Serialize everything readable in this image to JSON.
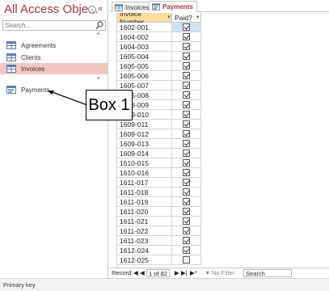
{
  "nav": {
    "title": "All Access Obje...",
    "search_placeholder": "Search...",
    "items": [
      {
        "label": "Agreements"
      },
      {
        "label": "Clients"
      },
      {
        "label": "Invoices"
      },
      {
        "label": "Payments"
      }
    ]
  },
  "tabs": [
    {
      "label": "Invoices"
    },
    {
      "label": "Payments"
    }
  ],
  "datasheet": {
    "columns": [
      "Invoice Number",
      "Paid?"
    ],
    "rows": [
      {
        "invoice": "1602-001",
        "paid": true
      },
      {
        "invoice": "1604-002",
        "paid": true
      },
      {
        "invoice": "1604-003",
        "paid": true
      },
      {
        "invoice": "1605-004",
        "paid": true
      },
      {
        "invoice": "1605-005",
        "paid": true
      },
      {
        "invoice": "1605-006",
        "paid": true
      },
      {
        "invoice": "1605-007",
        "paid": true
      },
      {
        "invoice": "1606-008",
        "paid": true
      },
      {
        "invoice": "1608-009",
        "paid": true
      },
      {
        "invoice": "1609-010",
        "paid": true
      },
      {
        "invoice": "1609-011",
        "paid": true
      },
      {
        "invoice": "1609-012",
        "paid": true
      },
      {
        "invoice": "1609-013",
        "paid": true
      },
      {
        "invoice": "1609-014",
        "paid": true
      },
      {
        "invoice": "1610-015",
        "paid": true
      },
      {
        "invoice": "1610-016",
        "paid": true
      },
      {
        "invoice": "1611-017",
        "paid": true
      },
      {
        "invoice": "1611-018",
        "paid": true
      },
      {
        "invoice": "1611-019",
        "paid": true
      },
      {
        "invoice": "1611-020",
        "paid": true
      },
      {
        "invoice": "1611-021",
        "paid": true
      },
      {
        "invoice": "1611-022",
        "paid": true
      },
      {
        "invoice": "1611-023",
        "paid": true
      },
      {
        "invoice": "1612-024",
        "paid": true
      },
      {
        "invoice": "1612-025",
        "paid": false
      }
    ]
  },
  "record_nav": {
    "label": "Record:",
    "position": "1 of 82",
    "filter": "No Filter",
    "search": "Search"
  },
  "status_bar": {
    "text": "Primary key"
  },
  "callout": {
    "label": "Box 1"
  },
  "colors": {
    "accent": "#a4373a",
    "selected_nav": "#f4c7c4",
    "header": "#fbdd9f"
  }
}
